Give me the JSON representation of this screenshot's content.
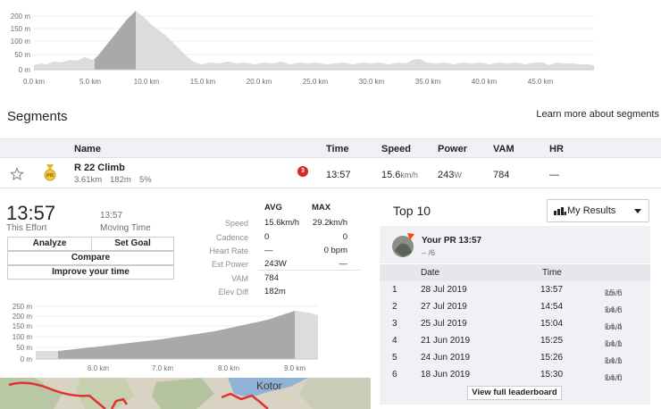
{
  "main_chart": {
    "y_ticks": [
      "200 m",
      "150 m",
      "100 m",
      "50 m",
      "0 m"
    ],
    "x_ticks": [
      "0.0 km",
      "5.0 km",
      "10.0 km",
      "15.0 km",
      "20.0 km",
      "25.0 km",
      "30.0 km",
      "35.0 km",
      "40.0 km",
      "45.0 km"
    ]
  },
  "segments": {
    "title": "Segments",
    "learn_more": "Learn more about segments",
    "columns": {
      "name": "Name",
      "time": "Time",
      "speed": "Speed",
      "power": "Power",
      "vam": "VAM",
      "hr": "HR"
    },
    "row": {
      "name": "R 22 Climb",
      "distance": "3.61km",
      "elevation": "182m",
      "grade": "5%",
      "badge": "3",
      "time": "13:57",
      "speed": "15.6",
      "speed_unit": "km/h",
      "power": "243",
      "power_unit": "W",
      "vam": "784",
      "hr": "—"
    }
  },
  "effort": {
    "time": "13:57",
    "time_label": "This Effort",
    "moving_time": "13:57",
    "moving_label": "Moving Time",
    "buttons": {
      "analyze": "Analyze",
      "set_goal": "Set Goal",
      "compare": "Compare",
      "improve": "Improve your time"
    },
    "stats_header": {
      "avg": "AVG",
      "max": "MAX"
    },
    "stats": [
      {
        "label": "Speed",
        "avg": "15.6km/h",
        "max": "29.2km/h"
      },
      {
        "label": "Cadence",
        "avg": "0",
        "max": "0"
      },
      {
        "label": "Heart Rate",
        "avg": "—",
        "max": "0 bpm"
      },
      {
        "label": "Est Power",
        "avg": "243W",
        "max": "—"
      },
      {
        "label": "VAM",
        "avg": "784",
        "max": ""
      },
      {
        "label": "Elev Diff",
        "avg": "182m",
        "max": ""
      }
    ]
  },
  "mini_chart": {
    "y_ticks": [
      "250 m",
      "200 m",
      "150 m",
      "100 m",
      "50 m",
      "0 m"
    ],
    "x_ticks": [
      "6.0 km",
      "7.0 km",
      "8.0 km",
      "9.0 km"
    ]
  },
  "map": {
    "place_label": "Kotor"
  },
  "top10": {
    "title": "Top 10",
    "filter": "My Results",
    "pr_title": "Your PR 13:57",
    "pr_sub": "– /6",
    "columns": {
      "date": "Date",
      "time": "Time"
    },
    "rows": [
      {
        "rank": "1",
        "date": "28 Jul 2019",
        "time": "13:57",
        "speed": "15.6",
        "unit": "km/h"
      },
      {
        "rank": "2",
        "date": "27 Jul 2019",
        "time": "14:54",
        "speed": "14.6",
        "unit": "km/h"
      },
      {
        "rank": "3",
        "date": "25 Jul 2019",
        "time": "15:04",
        "speed": "14.4",
        "unit": "km/h"
      },
      {
        "rank": "4",
        "date": "21 Jun 2019",
        "time": "15:25",
        "speed": "14.1",
        "unit": "km/h"
      },
      {
        "rank": "5",
        "date": "24 Jun 2019",
        "time": "15:26",
        "speed": "14.1",
        "unit": "km/h"
      },
      {
        "rank": "6",
        "date": "18 Jun 2019",
        "time": "15:30",
        "speed": "14.0",
        "unit": "km/h"
      }
    ],
    "view_full": "View full leaderboard"
  },
  "colors": {
    "accent": "#fc4c02",
    "profile_fill": "#dcdcdc",
    "segment_fill": "#aaaaaa",
    "route": "#e0322e"
  }
}
